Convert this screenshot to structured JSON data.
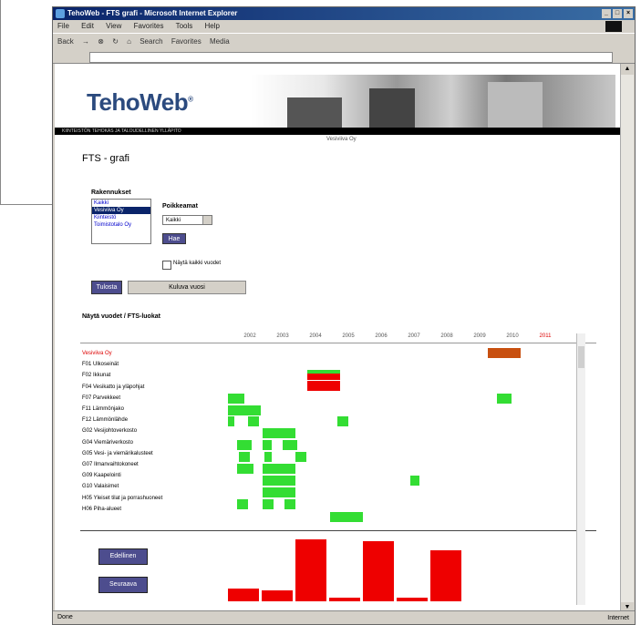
{
  "window": {
    "title": "TehoWeb - FTS grafi - Microsoft Internet Explorer"
  },
  "menu": [
    "File",
    "Edit",
    "View",
    "Favorites",
    "Tools",
    "Help"
  ],
  "toolbar": [
    "Back",
    "Search",
    "Favorites",
    "Media"
  ],
  "status": {
    "left": "Done",
    "zone": "Internet"
  },
  "logo": {
    "text": "TehoWeb",
    "mark": "®"
  },
  "banner_text": "KIINTEISTÖN TEHOKAS JA TALOUDELLINEN YLLÄPITO",
  "crumb": "Vesiviiva Oy",
  "page_title": "FTS - grafi",
  "form": {
    "list_label": "Rakennukset",
    "list_items": [
      "Kaikki",
      "Vesiviiva Oy",
      "Kiinteistö",
      "Toimistotalo Oy"
    ],
    "selected_index": 1,
    "period_label": "Poikkeamat",
    "period_value": "Kaikki",
    "hae_button": "Hae",
    "checkbox_label": "Näytä kaikki vuodet",
    "print_button": "Tulosta",
    "report_button": "Kuluva vuosi"
  },
  "section_title": "Näytä vuodet / FTS-luokat",
  "years": [
    "2002",
    "2003",
    "2004",
    "2005",
    "2006",
    "2007",
    "2008",
    "2009",
    "2010",
    "2011"
  ],
  "highlight_year": "2011",
  "rows": [
    "Vesiviiva Oy",
    "F01 Ulkoseinät",
    "F02 Ikkunat",
    "F04 Vesikatto ja yläpohjat",
    "F07 Parvekkeet",
    "F11 Lämmönjako",
    "F12 Lämmönlähde",
    "G02 Vesijohtoverkosto",
    "G04 Viemäriverkosto",
    "G05 Vesi- ja viemärikalusteet",
    "G07 Ilmanvaihtokoneet",
    "G09 Kaapelointi",
    "G10 Valaisimet",
    "H05 Yleiset tilat ja porrashuoneet",
    "H06 Piha-alueet"
  ],
  "footer_buttons": [
    "Edellinen",
    "Seuraava"
  ],
  "colors": {
    "green": "#33dd33",
    "red": "#ee0000",
    "orange": "#c85010",
    "accent": "#4d4d8e"
  }
}
